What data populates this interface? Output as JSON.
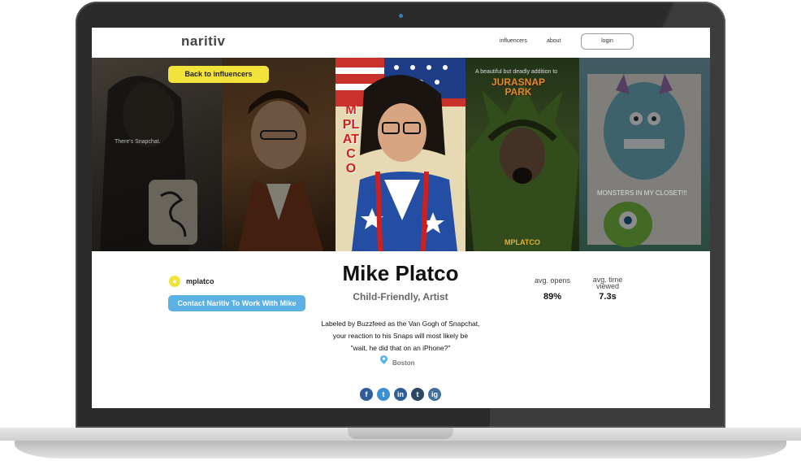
{
  "nav": {
    "logo": "naritiv",
    "links": [
      "influencers",
      "about"
    ],
    "login_label": "login"
  },
  "banner": {
    "back_button_label": "Back to influencers",
    "captions": {
      "tile1": "There's Snapchat.",
      "tile4_top": "A beautiful but deadly addition to",
      "tile4_title": "JURASNAP PARK",
      "tile3_vertical": "MPLATCO",
      "tile4_sign": "MPLATCO",
      "tile5": "MONSTERS IN MY CLOSET!!!"
    }
  },
  "profile": {
    "username": "mplatco",
    "contact_label": "Contact Naritiv To Work With Mike",
    "name": "Mike Platco",
    "tags": "Child-Friendly, Artist",
    "bio_lines": [
      "Labeled by Buzzfeed as the Van Gogh of Snapchat,",
      "your reaction to his Snaps will most likely be",
      "\"wait, he did that on an iPhone?\""
    ],
    "location": "Boston",
    "stats": {
      "opens_label": "avg. opens",
      "opens_value": "89%",
      "time_label_1": "avg. time",
      "time_label_2": "viewed",
      "time_value": "7.3s"
    },
    "social": [
      "f",
      "t",
      "in",
      "t",
      "ig"
    ]
  },
  "colors": {
    "accent_yellow": "#f2e33b",
    "contact_blue": "#5bb0e4"
  }
}
